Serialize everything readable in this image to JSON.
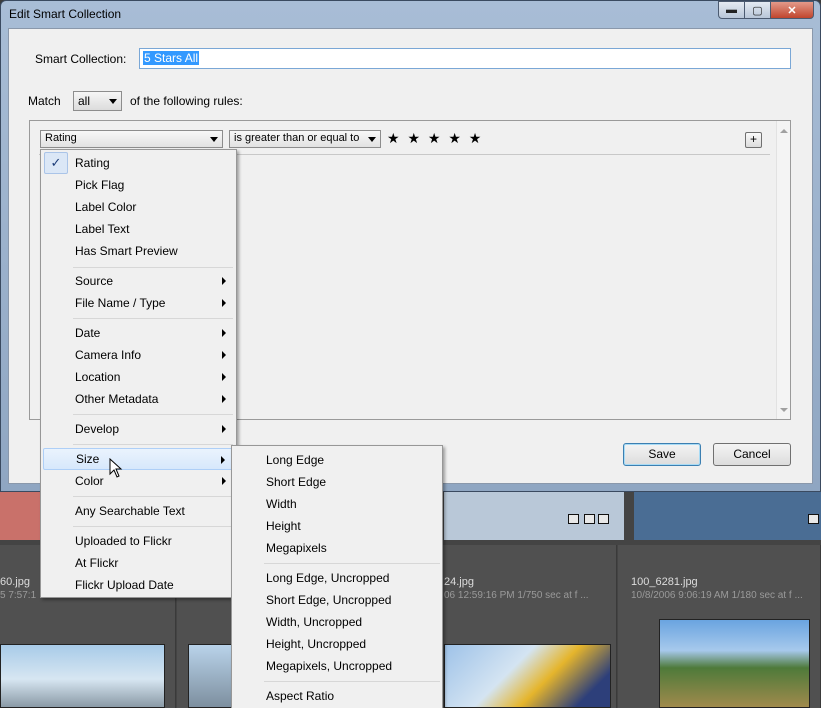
{
  "window": {
    "title": "Edit Smart Collection",
    "minimize_glyph": "▬",
    "maximize_glyph": "▢",
    "close_glyph": "✕"
  },
  "smart_collection": {
    "label": "Smart Collection:",
    "name_value": "5 Stars All"
  },
  "match": {
    "prefix": "Match",
    "value": "all",
    "suffix": "of the following rules:"
  },
  "rule": {
    "field": "Rating",
    "operator": "is greater than or equal to",
    "stars": "★ ★ ★ ★ ★",
    "add_label": "+"
  },
  "buttons": {
    "save": "Save",
    "cancel": "Cancel"
  },
  "field_menu": {
    "checked_glyph": "✓",
    "items": [
      "Rating",
      "Pick Flag",
      "Label Color",
      "Label Text",
      "Has Smart Preview",
      "Source",
      "File Name / Type",
      "Date",
      "Camera Info",
      "Location",
      "Other Metadata",
      "Develop",
      "Size",
      "Color",
      "Any Searchable Text",
      "Uploaded to Flickr",
      "At Flickr",
      "Flickr Upload Date"
    ]
  },
  "size_submenu": {
    "items": [
      "Long Edge",
      "Short Edge",
      "Width",
      "Height",
      "Megapixels",
      "Long Edge, Uncropped",
      "Short Edge, Uncropped",
      "Width, Uncropped",
      "Height, Uncropped",
      "Megapixels, Uncropped",
      "Aspect Ratio"
    ]
  },
  "grid": {
    "files": [
      {
        "name": "60.jpg",
        "meta": "5 7:57:1"
      },
      {
        "name": "24.jpg",
        "meta": "06 12:59:16 PM     1/750 sec at f ..."
      },
      {
        "name": "100_6281.jpg",
        "meta": "10/8/2006 9:06:19 AM     1/180 sec at f ..."
      }
    ]
  },
  "colors": {
    "accent": "#3399ff",
    "menu_highlight": "#d7e8fc",
    "titlebar": "#a8bdd6"
  }
}
